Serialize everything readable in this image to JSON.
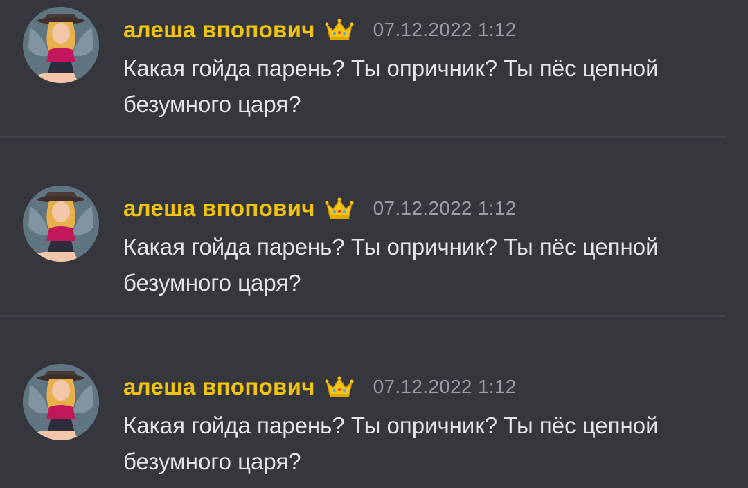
{
  "messages": [
    {
      "author": "алеша впопович",
      "badge_icon": "crown-icon",
      "timestamp": "07.12.2022 1:12",
      "text": "Какая гойда парень? Ты опричник? Ты пёс цепной безумного царя?"
    },
    {
      "author": "алеша впопович",
      "badge_icon": "crown-icon",
      "timestamp": "07.12.2022 1:12",
      "text": "Какая гойда парень? Ты опричник? Ты пёс цепной безумного царя?"
    },
    {
      "author": "алеша впопович",
      "badge_icon": "crown-icon",
      "timestamp": "07.12.2022 1:12",
      "text": "Какая гойда парень? Ты опричник? Ты пёс цепной безумного царя?"
    }
  ],
  "colors": {
    "background": "#35373c",
    "username": "#f1c40f",
    "timestamp": "#9a9da3",
    "message_text": "#e3e5e8",
    "divider": "#3f4248"
  }
}
